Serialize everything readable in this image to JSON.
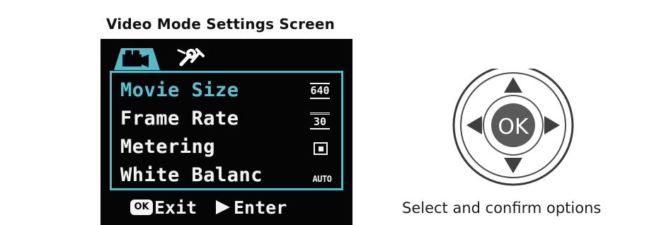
{
  "header": {
    "title": "Video Mode Settings Screen"
  },
  "camera_screen": {
    "tabs": [
      {
        "icon": "movie-camera-icon",
        "selected": true
      },
      {
        "icon": "tools-icon",
        "selected": false
      }
    ],
    "menu_items": [
      {
        "label": "Movie Size",
        "value": "640",
        "selected": true
      },
      {
        "label": "Frame Rate",
        "value": "30",
        "selected": false
      },
      {
        "label": "Metering",
        "value": "",
        "icon": "metering-icon",
        "selected": false
      },
      {
        "label": "White Balanc",
        "value": "AUTO",
        "selected": false
      }
    ],
    "footer": {
      "ok_badge": "OK",
      "exit_label": "Exit",
      "play_icon": "play-icon",
      "enter_label": "Enter"
    },
    "colors": {
      "accent": "#58b8c8",
      "selected_text": "#5bc1d1",
      "text": "#f2f2f2",
      "background": "#050505"
    }
  },
  "dpad": {
    "center_label": "OK",
    "directions": [
      "up",
      "right",
      "down",
      "left"
    ]
  },
  "caption": "Select and confirm options"
}
